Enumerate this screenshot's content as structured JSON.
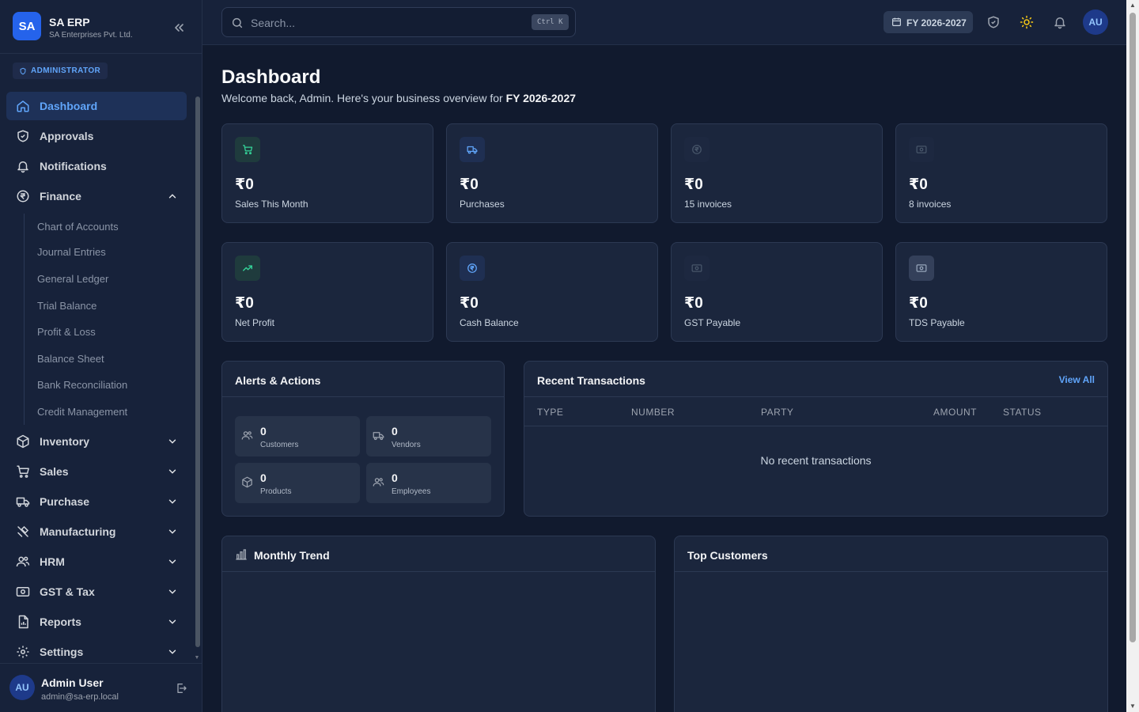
{
  "brand": {
    "logo": "SA",
    "name": "SA ERP",
    "company": "SA Enterprises Pvt. Ltd."
  },
  "role_badge": "ADMINISTRATOR",
  "sidebar": {
    "items": [
      {
        "label": "Dashboard",
        "icon": "home-icon"
      },
      {
        "label": "Approvals",
        "icon": "shield-check-icon"
      },
      {
        "label": "Notifications",
        "icon": "bell-icon"
      },
      {
        "label": "Finance",
        "icon": "rupee-circle-icon"
      },
      {
        "label": "Inventory",
        "icon": "box-icon"
      },
      {
        "label": "Sales",
        "icon": "cart-icon"
      },
      {
        "label": "Purchase",
        "icon": "truck-icon"
      },
      {
        "label": "Manufacturing",
        "icon": "tools-icon"
      },
      {
        "label": "HRM",
        "icon": "users-icon"
      },
      {
        "label": "GST & Tax",
        "icon": "banknote-icon"
      },
      {
        "label": "Reports",
        "icon": "file-chart-icon"
      },
      {
        "label": "Settings",
        "icon": "gear-icon"
      }
    ],
    "finance_sub": [
      "Chart of Accounts",
      "Journal Entries",
      "General Ledger",
      "Trial Balance",
      "Profit & Loss",
      "Balance Sheet",
      "Bank Reconciliation",
      "Credit Management"
    ]
  },
  "user": {
    "initials": "AU",
    "name": "Admin User",
    "email": "admin@sa-erp.local"
  },
  "topbar": {
    "search_placeholder": "Search...",
    "shortcut": "Ctrl K",
    "fiscal_year": "FY 2026-2027",
    "avatar": "AU"
  },
  "page": {
    "title": "Dashboard",
    "subtitle_prefix": "Welcome back, Admin. Here's your business overview for ",
    "subtitle_fy": "FY 2026-2027"
  },
  "stats": [
    {
      "value": "₹0",
      "label": "Sales This Month",
      "icon": "cart-icon",
      "color": "#34d399"
    },
    {
      "value": "₹0",
      "label": "Purchases",
      "icon": "truck-icon",
      "color": "#60a5fa"
    },
    {
      "value": "₹0",
      "label": "15 invoices",
      "icon": "rupee-circle-icon",
      "color": "#475569"
    },
    {
      "value": "₹0",
      "label": "8 invoices",
      "icon": "banknote-icon",
      "color": "#475569"
    },
    {
      "value": "₹0",
      "label": "Net Profit",
      "icon": "trend-up-icon",
      "color": "#34d399"
    },
    {
      "value": "₹0",
      "label": "Cash Balance",
      "icon": "rupee-circle-icon",
      "color": "#60a5fa"
    },
    {
      "value": "₹0",
      "label": "GST Payable",
      "icon": "banknote-icon",
      "color": "#475569"
    },
    {
      "value": "₹0",
      "label": "TDS Payable",
      "icon": "banknote-icon",
      "color": "#94a3b8"
    }
  ],
  "alerts": {
    "title": "Alerts & Actions",
    "cards": [
      {
        "value": "0",
        "label": "Customers",
        "icon": "users-icon"
      },
      {
        "value": "0",
        "label": "Vendors",
        "icon": "truck-icon"
      },
      {
        "value": "0",
        "label": "Products",
        "icon": "box-icon"
      },
      {
        "value": "0",
        "label": "Employees",
        "icon": "users-icon"
      }
    ]
  },
  "recent": {
    "title": "Recent Transactions",
    "view_all": "View All",
    "columns": [
      "TYPE",
      "NUMBER",
      "PARTY",
      "AMOUNT",
      "STATUS"
    ],
    "empty": "No recent transactions"
  },
  "monthly_trend": {
    "title": "Monthly Trend",
    "icon": "bar-chart-icon"
  },
  "top_customers": {
    "title": "Top Customers"
  },
  "colors": {
    "accent": "#2563eb",
    "link": "#60a5fa",
    "positive": "#34d399",
    "background": "#111a2e"
  }
}
